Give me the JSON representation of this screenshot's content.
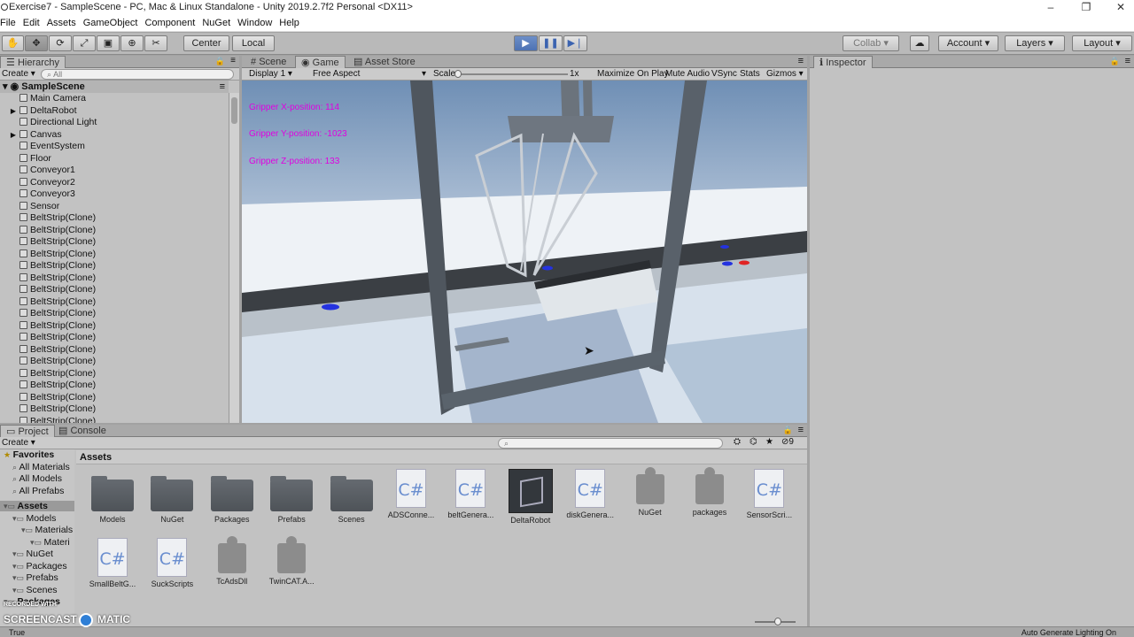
{
  "window": {
    "title": "Exercise7 - SampleScene - PC, Mac & Linux Standalone - Unity 2019.2.7f2 Personal <DX11>",
    "controls": [
      "–",
      "❐",
      "✕"
    ]
  },
  "menu": [
    "File",
    "Edit",
    "Assets",
    "GameObject",
    "Component",
    "NuGet",
    "Window",
    "Help"
  ],
  "toolbar": {
    "pivot": "Center",
    "space": "Local",
    "collab": "Collab",
    "account": "Account",
    "layers": "Layers",
    "layout": "Layout"
  },
  "hierarchy": {
    "tab": "Hierarchy",
    "create": "Create",
    "search_placeholder": "All",
    "scene": "SampleScene",
    "items": [
      "Main Camera",
      "DeltaRobot",
      "Directional Light",
      "Canvas",
      "EventSystem",
      "Floor",
      "Conveyor1",
      "Conveyor2",
      "Conveyor3",
      "Sensor",
      "BeltStrip(Clone)",
      "BeltStrip(Clone)",
      "BeltStrip(Clone)",
      "BeltStrip(Clone)",
      "BeltStrip(Clone)",
      "BeltStrip(Clone)",
      "BeltStrip(Clone)",
      "BeltStrip(Clone)",
      "BeltStrip(Clone)",
      "BeltStrip(Clone)",
      "BeltStrip(Clone)",
      "BeltStrip(Clone)",
      "BeltStrip(Clone)",
      "BeltStrip(Clone)",
      "BeltStrip(Clone)",
      "BeltStrip(Clone)",
      "BeltStrip(Clone)",
      "BeltStrip(Clone)"
    ]
  },
  "view_tabs": [
    "Scene",
    "Game",
    "Asset Store"
  ],
  "game_bar": {
    "display": "Display 1",
    "aspect": "Free Aspect",
    "scale_label": "Scale",
    "scale_value": "1x",
    "maximize": "Maximize On Play",
    "mute": "Mute Audio",
    "vsync": "VSync",
    "stats": "Stats",
    "gizmos": "Gizmos"
  },
  "game_overlay": {
    "x": "Gripper X-position: 114",
    "y": "Gripper Y-position: -1023",
    "z": "Gripper Z-position: 133"
  },
  "inspector": {
    "tab": "Inspector"
  },
  "project": {
    "tabs": [
      "Project",
      "Console"
    ],
    "create": "Create",
    "hidden_count": "9",
    "breadcrumb": "Assets",
    "tree": [
      {
        "label": "Favorites",
        "level": 0
      },
      {
        "label": "All Materials",
        "level": 1
      },
      {
        "label": "All Models",
        "level": 1
      },
      {
        "label": "All Prefabs",
        "level": 1
      },
      {
        "label": "Assets",
        "level": 0
      },
      {
        "label": "Models",
        "level": 1
      },
      {
        "label": "Materials",
        "level": 2
      },
      {
        "label": "Materi",
        "level": 3
      },
      {
        "label": "NuGet",
        "level": 1
      },
      {
        "label": "Packages",
        "level": 1
      },
      {
        "label": "Prefabs",
        "level": 1
      },
      {
        "label": "Scenes",
        "level": 1
      },
      {
        "label": "Packages",
        "level": 0
      }
    ],
    "assets": [
      {
        "label": "Models",
        "kind": "folder"
      },
      {
        "label": "NuGet",
        "kind": "folder"
      },
      {
        "label": "Packages",
        "kind": "folder"
      },
      {
        "label": "Prefabs",
        "kind": "folder"
      },
      {
        "label": "Scenes",
        "kind": "folder"
      },
      {
        "label": "ADSConne...",
        "kind": "script"
      },
      {
        "label": "beltGenera...",
        "kind": "script"
      },
      {
        "label": "DeltaRobot",
        "kind": "model"
      },
      {
        "label": "diskGenera...",
        "kind": "script"
      },
      {
        "label": "NuGet",
        "kind": "plugin"
      },
      {
        "label": "packages",
        "kind": "plugin"
      },
      {
        "label": "SensorScri...",
        "kind": "script"
      },
      {
        "label": "SmallBeltG...",
        "kind": "script"
      },
      {
        "label": "SuckScripts",
        "kind": "script"
      },
      {
        "label": "TcAdsDll",
        "kind": "plugin"
      },
      {
        "label": "TwinCAT.A...",
        "kind": "plugin"
      }
    ],
    "script_glyph": "C#"
  },
  "statusbar": {
    "left": "True",
    "right": "Auto Generate Lighting On"
  },
  "watermark": {
    "line1": "RECORDED WITH",
    "line2a": "SCREENCAST",
    "line2b": "MATIC"
  },
  "colors": {
    "gripper_text": "#e000e0",
    "play_accent": "#4d72b3"
  }
}
